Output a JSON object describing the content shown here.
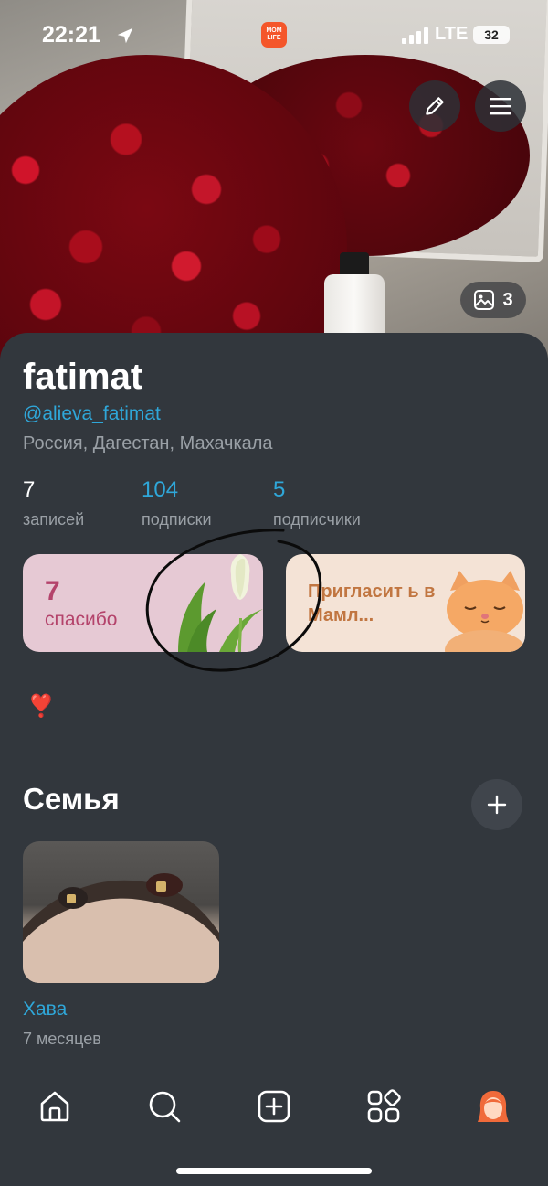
{
  "status_bar": {
    "time": "22:21",
    "network": "LTE",
    "battery": "32",
    "app_badge": "MOM LIFE"
  },
  "cover": {
    "photo_count": "3"
  },
  "profile": {
    "name": "fatimat",
    "handle": "@alieva_fatimat",
    "location": "Россия, Дагестан, Махачкала"
  },
  "stats": [
    {
      "value": "7",
      "label": "записей"
    },
    {
      "value": "104",
      "label": "подписки"
    },
    {
      "value": "5",
      "label": "подписчики"
    }
  ],
  "cards": {
    "thanks_count": "7",
    "thanks_label": "спасибо",
    "invite_label": "Пригласит ь в Мамл..."
  },
  "bio": {
    "emoji": "❣️"
  },
  "family": {
    "title": "Семья",
    "children": [
      {
        "name": "Хава",
        "age": "7 месяцев"
      }
    ]
  },
  "tabbar": {
    "items": [
      "home-icon",
      "search-icon",
      "add-post-icon",
      "services-icon",
      "profile-avatar-icon"
    ]
  },
  "colors": {
    "background": "#32373d",
    "accent_blue": "#2fa7d9",
    "muted_text": "#9aa0a6",
    "brand_orange": "#f4562a"
  }
}
